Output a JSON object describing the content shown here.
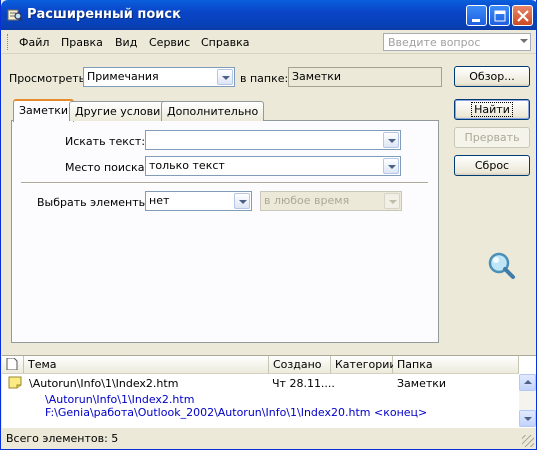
{
  "window": {
    "title": "Расширенный поиск"
  },
  "menu": [
    "Файл",
    "Правка",
    "Вид",
    "Сервис",
    "Справка"
  ],
  "help_box": {
    "placeholder": "Введите вопрос"
  },
  "look_for": {
    "label": "Просмотреть:",
    "value": "Примечания"
  },
  "in_folder": {
    "label": "в папке:",
    "value": "Заметки"
  },
  "buttons": {
    "browse": "Обзор...",
    "find": "Найти",
    "stop": "Прервать",
    "reset": "Сброс"
  },
  "tabs": [
    "Заметки",
    "Другие условия",
    "Дополнительно"
  ],
  "search_text": {
    "label": "Искать текст:",
    "value": ""
  },
  "search_in": {
    "label": "Место поиска:",
    "value": "только текст"
  },
  "select_items": {
    "label": "Выбрать элементы:",
    "value": "нет",
    "time_value": "в любое время"
  },
  "columns": [
    "Тема",
    "Создано",
    "Категории",
    "Папка"
  ],
  "results": [
    {
      "subject": "\\Autorun\\Info\\1\\Index2.htm",
      "created": "Чт 28.11....",
      "categories": "",
      "folder": "Заметки",
      "preview": [
        "\\Autorun\\Info\\1\\Index2.htm",
        "F:\\Genia\\работа\\Outlook_2002\\Autorun\\Info\\1\\Index20.htm <конец>"
      ]
    }
  ],
  "status": "Всего элементов: 5",
  "colors": {
    "titlebar": "#0a44c8",
    "face": "#ece9d8",
    "tab_accent": "#e68b2c",
    "preview_text": "#0000c8"
  }
}
